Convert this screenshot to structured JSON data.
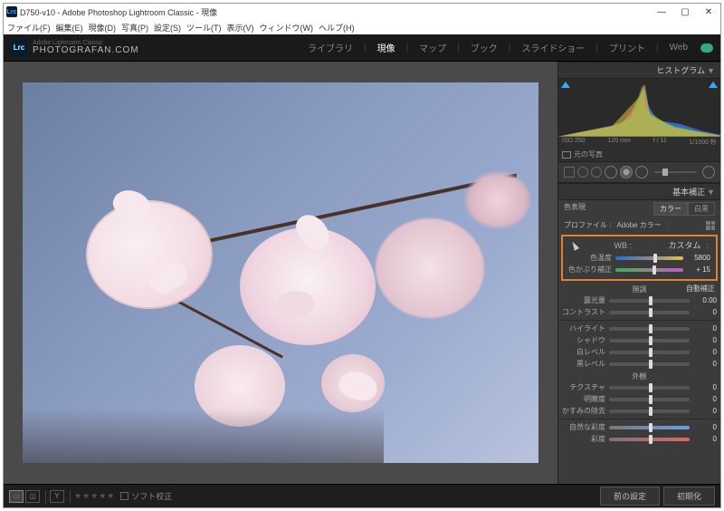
{
  "window": {
    "title": "D750-v10 - Adobe Photoshop Lightroom Classic - 現像",
    "lrc": "Lrc"
  },
  "menu": [
    "ファイル(F)",
    "編集(E)",
    "現像(D)",
    "写真(P)",
    "設定(S)",
    "ツール(T)",
    "表示(V)",
    "ウィンドウ(W)",
    "ヘルプ(H)"
  ],
  "brand": {
    "sub": "Adobe Lightroom Classic",
    "main": "PHOTOGRAFAN.COM"
  },
  "modules": [
    "ライブラリ",
    "現像",
    "マップ",
    "ブック",
    "スライドショー",
    "プリント",
    "Web"
  ],
  "active_module": "現像",
  "histogram": {
    "title": "ヒストグラム",
    "meta": [
      "ISO 250",
      "120 mm",
      "f / 11",
      "1/1000 秒"
    ],
    "orig": "元の写真"
  },
  "basic": {
    "title": "基本補正",
    "treatment_label": "色表現",
    "treatment_color": "カラー",
    "treatment_bw": "白黒",
    "profile_label": "プロファイル :",
    "profile_value": "Adobe カラー",
    "wb": {
      "label": "WB :",
      "value": "カスタム",
      "temp_label": "色温度",
      "temp_value": "5800",
      "tint_label": "色かぶり補正",
      "tint_value": "+ 15"
    },
    "tone_header": "階調",
    "auto": "自動補正",
    "exposure": {
      "label": "露光量",
      "value": "0.00"
    },
    "contrast": {
      "label": "コントラスト",
      "value": "0"
    },
    "highlights": {
      "label": "ハイライト",
      "value": "0"
    },
    "shadows": {
      "label": "シャドウ",
      "value": "0"
    },
    "whites": {
      "label": "白レベル",
      "value": "0"
    },
    "blacks": {
      "label": "黒レベル",
      "value": "0"
    },
    "presence_header": "外観",
    "texture": {
      "label": "テクスチャ",
      "value": "0"
    },
    "clarity": {
      "label": "明瞭度",
      "value": "0"
    },
    "dehaze": {
      "label": "かすみの除去",
      "value": "0"
    },
    "vibrance": {
      "label": "自然な彩度",
      "value": "0"
    },
    "saturation": {
      "label": "彩度",
      "value": "0"
    }
  },
  "bottom": {
    "soft": "ソフト校正",
    "prev": "前の設定",
    "reset": "初期化",
    "stars": "★★★★★"
  }
}
